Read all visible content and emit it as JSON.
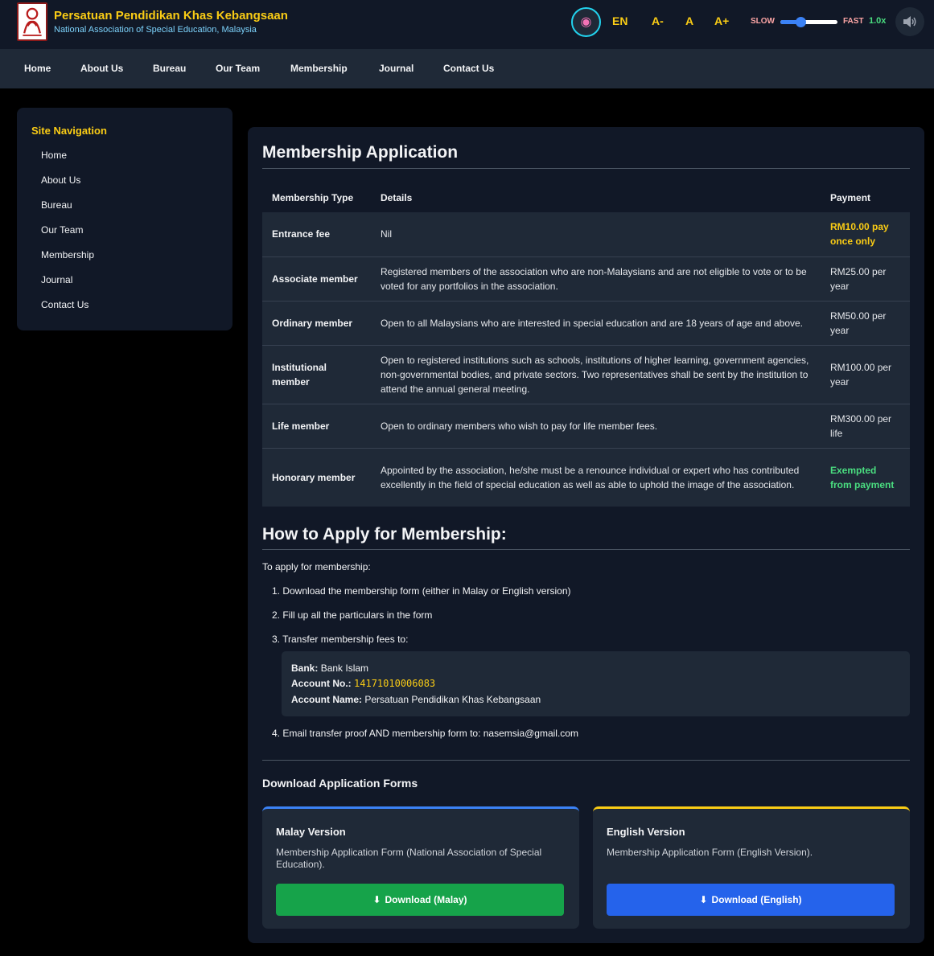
{
  "header": {
    "title": "Persatuan Pendidikan Khas Kebangsaan",
    "subtitle": "National Association of Special Education, Malaysia",
    "language": "EN",
    "font_decrease": "A-",
    "font_normal": "A",
    "font_increase": "A+",
    "speed_slow": "SLOW",
    "speed_fast": "FAST",
    "speed_value": "1.0x",
    "speed_level": 0.35
  },
  "nav": {
    "items": [
      "Home",
      "About Us",
      "Bureau",
      "Our Team",
      "Membership",
      "Journal",
      "Contact Us"
    ]
  },
  "sidebar": {
    "title": "Site Navigation",
    "items": [
      "Home",
      "About Us",
      "Bureau",
      "Our Team",
      "Membership",
      "Journal",
      "Contact Us"
    ]
  },
  "main": {
    "title": "Membership Application",
    "table": {
      "headers": [
        "Membership Type",
        "Details",
        "Payment"
      ],
      "rows": [
        {
          "type": "Entrance fee",
          "details": "Nil",
          "payment": "RM10.00 pay once only"
        },
        {
          "type": "Associate member",
          "details": "Registered members of the association who are non-Malaysians and are not eligible to vote or to be voted for any portfolios in the association.",
          "payment": "RM25.00 per year"
        },
        {
          "type": "Ordinary member",
          "details": "Open to all Malaysians who are interested in special education and are 18 years of age and above.",
          "payment": "RM50.00 per year"
        },
        {
          "type": "Institutional member",
          "details": "Open to registered institutions such as schools, institutions of higher learning, government agencies, non-governmental bodies, and private sectors. Two representatives shall be sent by the institution to attend the annual general meeting.",
          "payment": "RM100.00 per year"
        },
        {
          "type": "Life member",
          "details": "Open to ordinary members who wish to pay for life member fees.",
          "payment": "RM300.00 per life"
        },
        {
          "type": "Honorary member",
          "details": "Appointed by the association, he/she must be a renounce individual or expert who has contributed excellently in the field of special education as well as able to uphold the image of the association.",
          "payment": "Exempted from payment"
        }
      ]
    },
    "apply": {
      "title": "How to Apply for Membership:",
      "intro": "To apply for membership:",
      "step1": "1. Download the membership form (either in Malay or English version)",
      "step2": "2. Fill up all the particulars in the form",
      "step3": "3. Transfer membership fees to:",
      "bank_label": "Bank:",
      "bank_value": "Bank Islam",
      "account_no_label": "Account No.:",
      "account_no_value": "14171010006083",
      "account_name_label": "Account Name:",
      "account_name_value": "Persatuan Pendidikan Khas Kebangsaan",
      "step4": "4. Email transfer proof AND membership form to: nasemsia@gmail.com"
    },
    "downloads": {
      "title": "Download Application Forms",
      "malay": {
        "title": "Malay Version",
        "desc": "Membership Application Form (National Association of Special Education).",
        "button": "Download (Malay)"
      },
      "english": {
        "title": "English Version",
        "desc": "Membership Application Form (English Version).",
        "button": "Download (English)"
      }
    }
  },
  "colors": {
    "accent_yellow": "#facc15",
    "accent_green": "#4ade80",
    "button_green": "#16a34a",
    "button_blue": "#2563eb"
  }
}
